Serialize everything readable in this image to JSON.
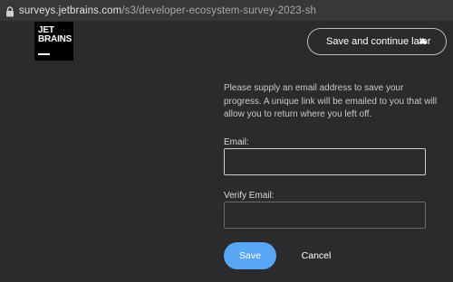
{
  "browser": {
    "url_host": "surveys.jetbrains.com",
    "url_path": "/s3/developer-ecosystem-survey-2023-sh"
  },
  "logo": {
    "line1": "JET",
    "line2": "BRAINS"
  },
  "header": {
    "save_later_label": "Save and continue later"
  },
  "form": {
    "info_text": "Please supply an email address to save your progress. A unique link will be emailed to you that will allow you to return where you left off.",
    "email_label": "Email:",
    "email_value": "",
    "verify_label": "Verify Email:",
    "verify_value": "",
    "save_label": "Save",
    "cancel_label": "Cancel"
  },
  "colors": {
    "background": "#2b2b2d",
    "accent": "#58a7f5",
    "browser_bar": "#383838"
  }
}
